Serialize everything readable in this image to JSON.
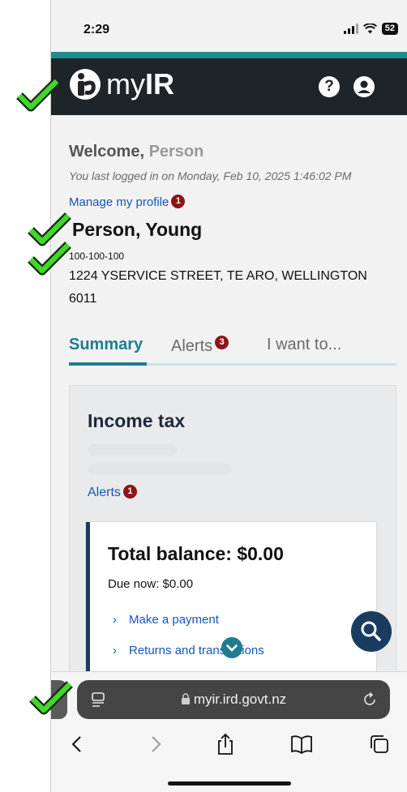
{
  "status_bar": {
    "time": "2:29",
    "battery": "52"
  },
  "header": {
    "logo_text": "myIR",
    "help": "?"
  },
  "welcome": {
    "label": "Welcome,",
    "name": "Person"
  },
  "last_login": "You last logged in on Monday, Feb 10, 2025 1:46:02 PM",
  "manage_profile": {
    "label": "Manage my profile",
    "badge": "1"
  },
  "customer": {
    "name": "Person, Young",
    "ird_number": "100-100-100",
    "address_line1": "1224 YSERVICE  STREET, TE ARO, WELLINGTON",
    "address_line2": "6011"
  },
  "tabs": {
    "summary": "Summary",
    "alerts": "Alerts",
    "alerts_badge": "3",
    "want": "I want to..."
  },
  "income_tax": {
    "title": "Income tax",
    "alerts_label": "Alerts",
    "alerts_badge": "1",
    "balance_title": "Total balance: $0.00",
    "due_now": "Due now: $0.00",
    "actions": [
      "Make a payment",
      "Returns and transactions"
    ]
  },
  "browser": {
    "url": "myir.ird.govt.nz"
  },
  "colors": {
    "header": "#1f2428",
    "teal": "#1b8e8a",
    "link": "#1458b8",
    "badge": "#8e1419",
    "navy": "#1a3d5f"
  }
}
